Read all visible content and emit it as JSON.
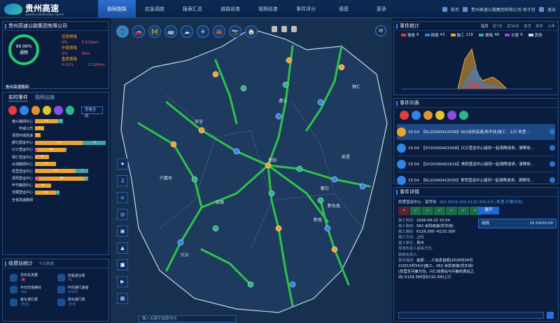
{
  "header": {
    "logo_main": "贵州高速",
    "logo_sub": "GUIZHOU EXPRESSWAY GROUP",
    "nav": [
      "协同指挥",
      "应急调度",
      "报表汇总",
      "道路巡查",
      "视频巡查",
      "事件评分",
      "语音",
      "更多"
    ],
    "home": "首页",
    "user": "贵州高速公路集团有限公司-徐子月",
    "logout": "退出"
  },
  "left_top": {
    "title": "贵州高速公路集团有限公司",
    "ring_value": "99.99%",
    "ring_label": "通畅",
    "levels": [
      {
        "label": "轻度拥堵",
        "pct": "0%",
        "len": "0.533km"
      },
      {
        "label": "中度拥堵",
        "pct": "0%",
        "len": "0km"
      },
      {
        "label": "重度拥堵",
        "pct": "0.01%",
        "len": "1.526km"
      }
    ],
    "region_tag": "贵州高速路网"
  },
  "events": {
    "tab_active": "实时事件",
    "tab_other": "路网设施",
    "view_all": "查看全部",
    "icon_colors": [
      "#e43d3d",
      "#2f86e8",
      "#e0922b",
      "#e2c52e",
      "#8a4ee0",
      "#2bb58a"
    ],
    "rows": [
      {
        "label": "遵义路网中心",
        "segs": [
          0,
          13,
          3
        ]
      },
      {
        "label": "毕威公司",
        "segs": [
          0,
          5,
          0
        ]
      },
      {
        "label": "贵阳环城高速",
        "segs": [
          0,
          3,
          0
        ]
      },
      {
        "label": "都匀营运中心",
        "segs": [
          0,
          27,
          13
        ]
      },
      {
        "label": "兴义营运中心",
        "segs": [
          1,
          16,
          1
        ]
      },
      {
        "label": "铜仁营运中心",
        "segs": [
          0,
          8,
          0
        ]
      },
      {
        "label": "水城路网中心",
        "segs": [
          0,
          12,
          0
        ]
      },
      {
        "label": "凯里营运中心",
        "segs": [
          0,
          23,
          7
        ]
      },
      {
        "label": "贵阳营运中心",
        "segs": [
          2,
          26,
          2
        ]
      },
      {
        "label": "毕节路网中心",
        "segs": [
          0,
          9,
          0
        ]
      },
      {
        "label": "安顺营运中心",
        "segs": [
          0,
          12,
          2
        ]
      },
      {
        "label": "全省高速路网",
        "segs": [
          0,
          0,
          0
        ]
      }
    ],
    "seg_colors": [
      "#d93c6a",
      "#f0a430",
      "#3ba3a3"
    ]
  },
  "toll": {
    "title": "收费站统计",
    "subtitle": "今日数据",
    "cells": [
      {
        "label": "当日车流量",
        "val": "-辆",
        "style": "r"
      },
      {
        "label": "交易成功率",
        "val": "-%",
        "style": "r"
      },
      {
        "label": "平均交易耗时",
        "val": "-ms",
        "style": "b"
      },
      {
        "label": "平均通行速度",
        "val": "-km/h",
        "style": "b"
      },
      {
        "label": "客车通行费",
        "val": "-万元",
        "style": "b"
      },
      {
        "label": "货车通行费",
        "val": "-万元",
        "style": "b"
      }
    ]
  },
  "map": {
    "search_placeholder": "输入关键字选取地点",
    "chips": [
      "",
      "",
      ""
    ],
    "labels": [
      "遵义",
      "毕节",
      "贵阳",
      "安顺",
      "六盘水",
      "都匀",
      "凯里",
      "铜仁",
      "兴义",
      "黔东南",
      "黔南"
    ]
  },
  "stats": {
    "title": "事件统计",
    "ranges": [
      "当月",
      "近7天",
      "近30天",
      "本月",
      "本年",
      "上年"
    ],
    "active_range": "当月",
    "legend": [
      {
        "label": "事故",
        "count": "8",
        "color": "#e43d3d"
      },
      {
        "label": "拥堵",
        "count": "43",
        "color": "#2f86e8"
      },
      {
        "label": "施工",
        "count": "118",
        "color": "#f0a430"
      },
      {
        "label": "拥堵",
        "count": "48",
        "color": "#2bb58a"
      },
      {
        "label": "灾害",
        "count": "9",
        "color": "#8a4ee0"
      },
      {
        "label": "其他",
        "count": "",
        "color": "#cfd8e6"
      }
    ]
  },
  "event_list": {
    "title": "事件列表",
    "icon_colors": [
      "#e43d3d",
      "#2f86e8",
      "#e0922b",
      "#e2c52e",
      "#8a4ee0",
      "#2bb58a"
    ],
    "items": [
      {
        "time": "15:54",
        "text": "【KL20260422039】S62余凯高速(凯羊线)施工：上行 凯里…",
        "color": "#f0a430"
      },
      {
        "time": "15:54",
        "text": "【XY20260422008】兴义营运中心接到一起清障请求。清障地…",
        "color": "#2f86e8"
      },
      {
        "time": "15:54",
        "text": "【GY20260422016】贵阳营运中心接到一起清障请求。清障地…",
        "color": "#2f86e8"
      },
      {
        "time": "15:54",
        "text": "【KL20260422030】贵阳营运中心接到一起清障请求。清障地…",
        "color": "#2f86e8"
      }
    ]
  },
  "detail": {
    "title": "事件详情",
    "owner": "凯里营运中心 · 郭乔伶",
    "road": "S62 K129.300-K132.300上行 (凯里-丹寨方向)",
    "steps": [
      "✕",
      "✓",
      "✓",
      "✓",
      "✓",
      "✓",
      "✓"
    ],
    "expand": "展开",
    "reply_label": "接报",
    "reply_time": "15:54/00:00",
    "rows": [
      {
        "k": "施工时间:",
        "v": "2026-04-22 15:54"
      },
      {
        "k": "施工路线:",
        "v": "S62 余凯高速(凯羊线)"
      },
      {
        "k": "施工路段:",
        "v": "K129.300~K132.300"
      },
      {
        "k": "施工方向:",
        "v": "上行"
      },
      {
        "k": "施工单位:",
        "v": "贵州"
      },
      {
        "k": "现场负责人联系方式:",
        "v": ""
      },
      {
        "k": "联络负责人:",
        "v": ""
      },
      {
        "k": "事件描述:",
        "v": "首报：…工信息首报[2026年04月22日15时54分]施工，S62 余凯高速(凯羊线) (凯里至丹寨方向，兴仁收费站与丹寨收费站之间) K129.300至K132.300上行"
      }
    ]
  }
}
